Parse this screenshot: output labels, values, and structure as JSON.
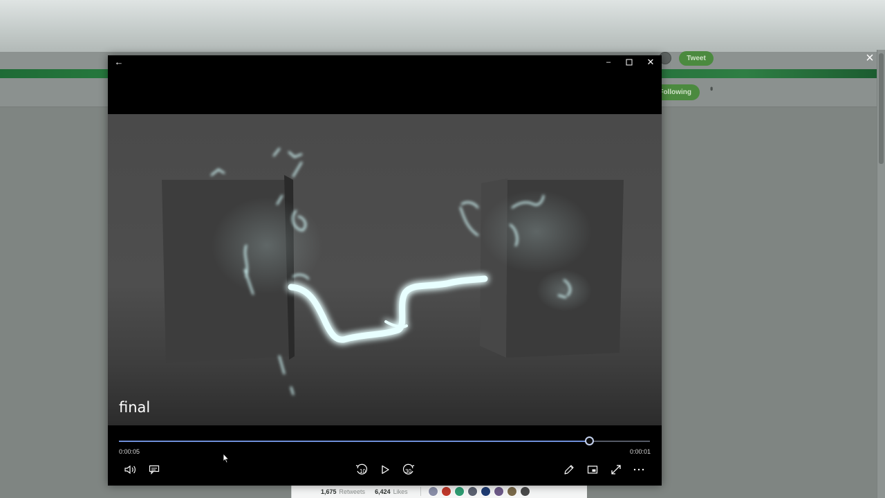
{
  "background_page": {
    "tweet_button": "Tweet",
    "following_button": "Following",
    "close_icon": "×",
    "stats": {
      "retweets_count": "1,675",
      "retweets_label": "Retweets",
      "likes_count": "6,424",
      "likes_label": "Likes"
    },
    "liker_avatar_colors": [
      "#8a8fa8",
      "#c0392b",
      "#2e9c72",
      "#5b6170",
      "#1f3c73",
      "#6d5a88",
      "#7a6a4a",
      "#4a4a4a"
    ]
  },
  "player": {
    "titlebar": {
      "back_icon": "←",
      "minimize_icon": "–",
      "maximize_icon": "☐",
      "close_icon": "✕"
    },
    "video_title": "final",
    "progress_fraction": 0.886,
    "time_elapsed": "0:00:05",
    "time_remaining": "0:00:01",
    "controls": {
      "left": [
        "volume-icon",
        "captions-icon"
      ],
      "center": [
        "skip-back-10-icon",
        "play-icon",
        "skip-forward-30-icon"
      ],
      "right": [
        "edit-pencil-icon",
        "mini-view-icon",
        "fullscreen-icon",
        "more-options-icon"
      ],
      "skip_back_label": "10",
      "skip_forward_label": "30"
    },
    "accent_color": "#6f8fd9"
  }
}
